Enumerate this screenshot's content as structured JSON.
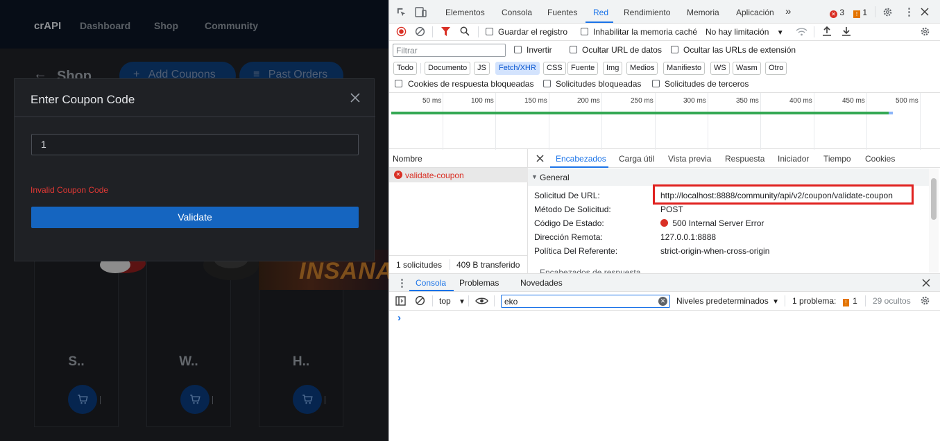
{
  "app": {
    "brand": "crAPI",
    "nav": [
      "Dashboard",
      "Shop",
      "Community"
    ],
    "page_title": "Shop",
    "add_coupons_label": "Add Coupons",
    "past_orders_label": "Past Orders",
    "products": [
      {
        "name": "S.."
      },
      {
        "name": "W.."
      },
      {
        "name": "H.."
      }
    ],
    "banner_text": "INSANAS"
  },
  "modal": {
    "title": "Enter Coupon Code",
    "input_value": "1",
    "error": "Invalid Coupon Code",
    "validate_label": "Validate"
  },
  "devtools": {
    "tabs": [
      "Elementos",
      "Consola",
      "Fuentes",
      "Red",
      "Rendimiento",
      "Memoria",
      "Aplicación"
    ],
    "active_tab": "Red",
    "more_tabs": "»",
    "errors_count": "3",
    "warnings_count": "1",
    "preserve_log": "Guardar el registro",
    "disable_cache": "Inhabilitar la memoria caché",
    "throttling": "No hay limitación",
    "filter_placeholder": "Filtrar",
    "invert": "Invertir",
    "hide_data_urls": "Ocultar URL de datos",
    "hide_ext_urls": "Ocultar las URLs de extensión",
    "type_filters": [
      "Todo",
      "Documento",
      "JS",
      "Fetch/XHR",
      "CSS",
      "Fuente",
      "Img",
      "Medios",
      "Manifiesto",
      "WS",
      "Wasm",
      "Otro"
    ],
    "active_type": "Fetch/XHR",
    "blocked_cookies": "Cookies de respuesta bloqueadas",
    "blocked_requests": "Solicitudes bloqueadas",
    "third_party": "Solicitudes de terceros",
    "timeline_labels": [
      "50 ms",
      "100 ms",
      "150 ms",
      "200 ms",
      "250 ms",
      "300 ms",
      "350 ms",
      "400 ms",
      "450 ms",
      "500 ms"
    ],
    "name_header": "Nombre",
    "request_name": "validate-coupon",
    "requests_summary": "1 solicitudes",
    "transferred": "409 B transferido",
    "detail_tabs": [
      "Encabezados",
      "Carga útil",
      "Vista previa",
      "Respuesta",
      "Iniciador",
      "Tiempo",
      "Cookies"
    ],
    "active_detail_tab": "Encabezados",
    "general_title": "General",
    "general": [
      {
        "key": "Solicitud De URL:",
        "value": "http://localhost:8888/community/api/v2/coupon/validate-coupon"
      },
      {
        "key": "Método De Solicitud:",
        "value": "POST"
      },
      {
        "key": "Código De Estado:",
        "value": "500 Internal Server Error"
      },
      {
        "key": "Dirección Remota:",
        "value": "127.0.0.1:8888"
      },
      {
        "key": "Política Del Referente:",
        "value": "strict-origin-when-cross-origin"
      }
    ],
    "response_headers_partial": "Encabezados de respuesta",
    "console_tabs": [
      "Consola",
      "Problemas",
      "Novedades"
    ],
    "active_console_tab": "Consola",
    "context": "top",
    "console_filter": "eko",
    "levels": "Niveles predeterminados",
    "issues_label": "1 problema:",
    "issues_count": "1",
    "hidden_count": "29 ocultos",
    "prompt": "›",
    "colors": {
      "accent": "#1a73e8",
      "error": "#e53935",
      "status_error_dot": "#d93025",
      "validate_button": "#1565c0"
    }
  }
}
